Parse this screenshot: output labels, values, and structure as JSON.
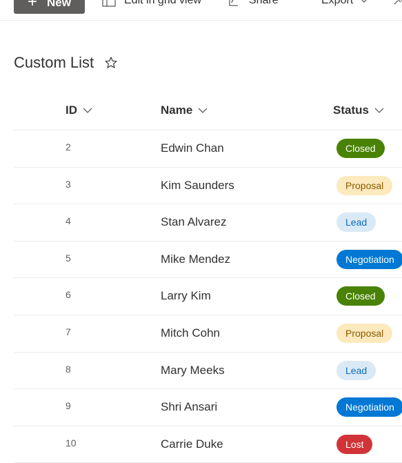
{
  "toolbar": {
    "new_label": "New",
    "grid_label": "Edit in grid view",
    "share_label": "Share",
    "export_label": "Export"
  },
  "list": {
    "title": "Custom List",
    "columns": {
      "id": "ID",
      "name": "Name",
      "status": "Status"
    },
    "rows": [
      {
        "id": "2",
        "name": "Edwin Chan",
        "status": "Closed"
      },
      {
        "id": "3",
        "name": "Kim Saunders",
        "status": "Proposal"
      },
      {
        "id": "4",
        "name": "Stan Alvarez",
        "status": "Lead"
      },
      {
        "id": "5",
        "name": "Mike Mendez",
        "status": "Negotiation"
      },
      {
        "id": "6",
        "name": "Larry Kim",
        "status": "Closed"
      },
      {
        "id": "7",
        "name": "Mitch Cohn",
        "status": "Proposal"
      },
      {
        "id": "8",
        "name": "Mary Meeks",
        "status": "Lead"
      },
      {
        "id": "9",
        "name": "Shri Ansari",
        "status": "Negotiation"
      },
      {
        "id": "10",
        "name": "Carrie Duke",
        "status": "Lost"
      }
    ]
  },
  "status_colors": {
    "Closed": {
      "bg": "#498205",
      "fg": "#ffffff"
    },
    "Proposal": {
      "bg": "#fce9bd",
      "fg": "#8a5a00"
    },
    "Lead": {
      "bg": "#d9e9f6",
      "fg": "#0f6cbd"
    },
    "Negotiation": {
      "bg": "#0078d4",
      "fg": "#ffffff"
    },
    "Lost": {
      "bg": "#d13438",
      "fg": "#ffffff"
    }
  }
}
